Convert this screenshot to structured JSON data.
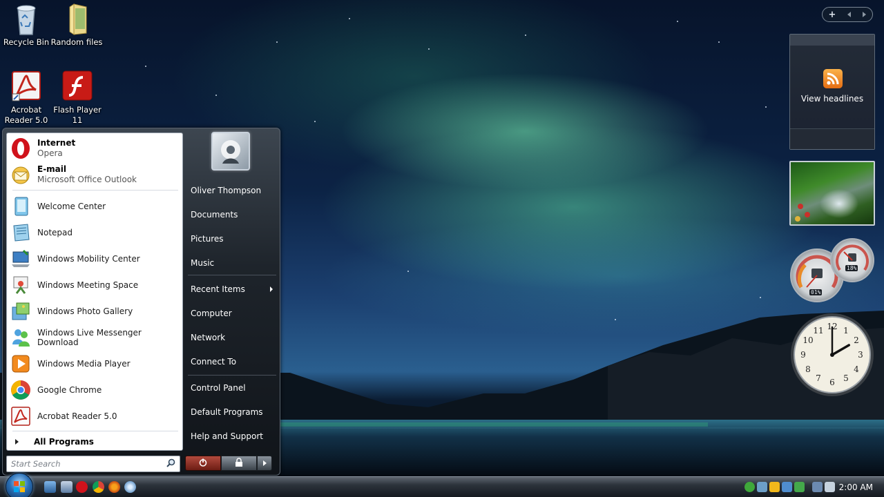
{
  "desktop": {
    "icons": [
      {
        "label": "Recycle Bin"
      },
      {
        "label": "Random files"
      },
      {
        "label": "Acrobat Reader 5.0"
      },
      {
        "label": "Flash Player 11"
      }
    ]
  },
  "start_menu": {
    "pinned": [
      {
        "title": "Internet",
        "subtitle": "Opera"
      },
      {
        "title": "E-mail",
        "subtitle": "Microsoft Office Outlook"
      }
    ],
    "recent": [
      {
        "label": "Welcome Center"
      },
      {
        "label": "Notepad"
      },
      {
        "label": "Windows Mobility Center"
      },
      {
        "label": "Windows Meeting Space"
      },
      {
        "label": "Windows Photo Gallery"
      },
      {
        "label": "Windows Live Messenger Download"
      },
      {
        "label": "Windows Media Player"
      },
      {
        "label": "Google Chrome"
      },
      {
        "label": "Acrobat Reader 5.0"
      }
    ],
    "all_programs_label": "All Programs",
    "search_placeholder": "Start Search",
    "right_items": [
      {
        "label": "Oliver Thompson"
      },
      {
        "label": "Documents"
      },
      {
        "label": "Pictures"
      },
      {
        "label": "Music"
      },
      {
        "label": "Recent Items"
      },
      {
        "label": "Computer"
      },
      {
        "label": "Network"
      },
      {
        "label": "Connect To"
      },
      {
        "label": "Control Panel"
      },
      {
        "label": "Default Programs"
      },
      {
        "label": "Help and Support"
      }
    ]
  },
  "sidebar": {
    "controls": {
      "add_label": "+"
    },
    "feed_gadget": {
      "label": "View headlines"
    },
    "cpu_meter": {
      "cpu_readout": "01%",
      "mem_readout": "18%"
    },
    "clock_gadget": {
      "hour": 2,
      "minute": 0
    }
  },
  "taskbar": {
    "clock": "2:00 AM"
  },
  "colors": {
    "accent_blue": "#2a6fb5",
    "start_menu_dark": "#1e242b",
    "power_red": "#b24a3d",
    "rss_orange": "#f08a1e"
  },
  "icons": [
    "recycle-bin-icon",
    "folder-icon",
    "acrobat-icon",
    "flash-icon",
    "opera-icon",
    "outlook-icon",
    "search-icon",
    "power-icon",
    "lock-icon",
    "rss-icon",
    "windows-orb-icon"
  ]
}
